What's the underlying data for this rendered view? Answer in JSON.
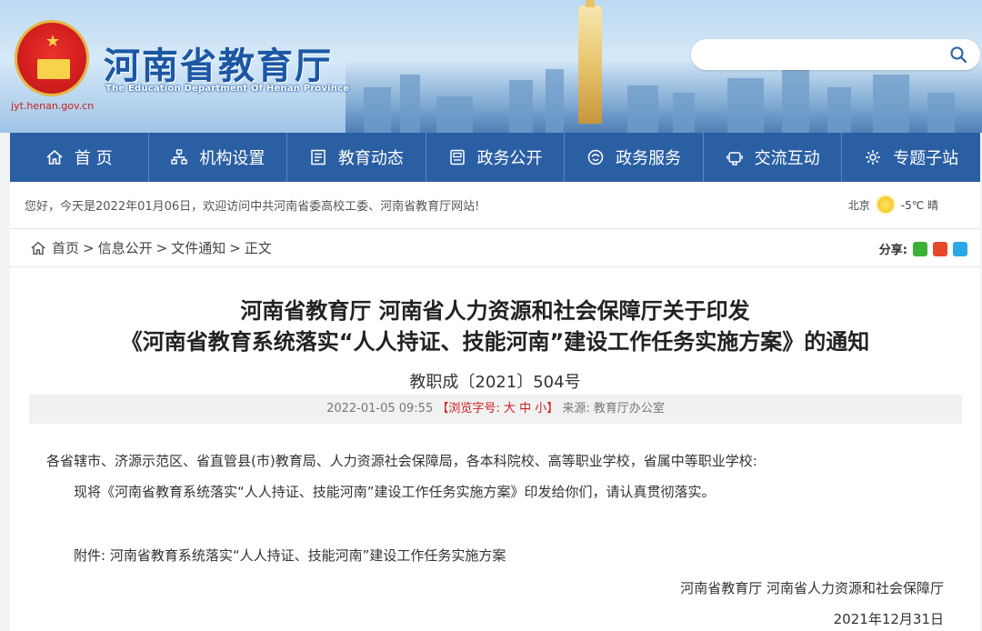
{
  "header": {
    "logo_title": "河南省教育厅",
    "logo_subtitle": "The Education Department Of Henan Province",
    "site_url": "jyt.henan.gov.cn",
    "search_placeholder": ""
  },
  "nav": {
    "items": [
      {
        "label": "首 页",
        "icon": "home-icon"
      },
      {
        "label": "机构设置",
        "icon": "org-icon"
      },
      {
        "label": "教育动态",
        "icon": "news-icon"
      },
      {
        "label": "政务公开",
        "icon": "document-icon"
      },
      {
        "label": "政务服务",
        "icon": "service-icon"
      },
      {
        "label": "交流互动",
        "icon": "chat-icon"
      },
      {
        "label": "专题子站",
        "icon": "gear-icon"
      }
    ]
  },
  "welcome": {
    "text": "您好，今天是2022年01月06日，欢迎访问中共河南省委高校工委、河南省教育厅网站!",
    "city": "北京",
    "weather": "-5℃ 晴"
  },
  "breadcrumb": {
    "items": [
      "首页",
      "信息公开",
      "文件通知"
    ],
    "current": "正文",
    "share_label": "分享:"
  },
  "article": {
    "title_line1": "河南省教育厅 河南省人力资源和社会保障厅关于印发",
    "title_line2": "《河南省教育系统落实“人人持证、技能河南”建设工作任务实施方案》的通知",
    "doc_no": "教职成〔2021〕504号",
    "meta": {
      "datetime": "2022-01-05 09:55",
      "font_label_open": "【浏览字号:",
      "font_large": "大",
      "font_medium": "中",
      "font_small": "小",
      "font_label_close": "】",
      "source": "来源: 教育厅办公室"
    },
    "recipients": "各省辖市、济源示范区、省直管县(市)教育局、人力资源社会保障局，各本科院校、高等职业学校，省属中等职业学校:",
    "body": "现将《河南省教育系统落实“人人持证、技能河南”建设工作任务实施方案》印发给你们，请认真贯彻落实。",
    "attachment": "附件: 河南省教育系统落实“人人持证、技能河南”建设工作任务实施方案",
    "signature": "河南省教育厅 河南省人力资源和社会保障厅",
    "date": "2021年12月31日"
  },
  "colors": {
    "nav_bg": "#2b5fa4",
    "brand_blue": "#1b57a4",
    "accent_red": "#cc1f1f"
  }
}
